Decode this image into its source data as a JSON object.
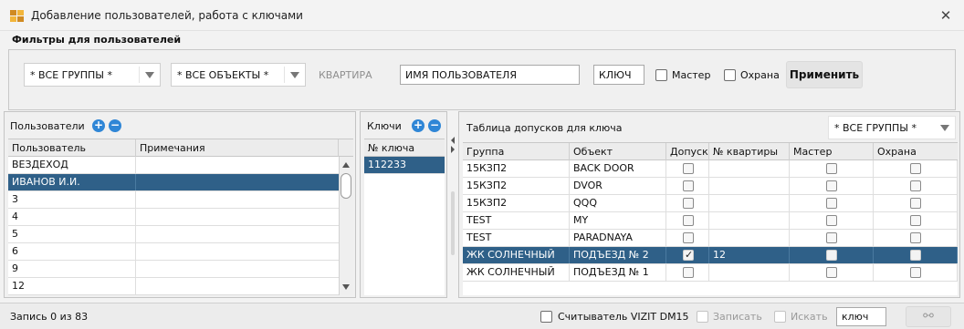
{
  "window": {
    "title": "Добавление пользователей, работа с ключами",
    "close_glyph": "✕"
  },
  "filters": {
    "title": "Фильтры для пользователей",
    "groups_value": "* ВСЕ ГРУППЫ *",
    "objects_value": "* ВСЕ ОБЪЕКТЫ *",
    "apartment_label": "КВАРТИРА",
    "username_value": "ИМЯ ПОЛЬЗОВАТЕЛЯ",
    "key_value": "КЛЮЧ",
    "master_label": "Мастер",
    "guard_label": "Охрана",
    "master_checked": false,
    "guard_checked": false,
    "apply_label": "Применить"
  },
  "users_panel": {
    "title": "Пользователи",
    "add_glyph": "+",
    "remove_glyph": "−",
    "columns": [
      "Пользователь",
      "Примечания"
    ],
    "rows": [
      {
        "user": "ВЕЗДЕХОД",
        "note": "",
        "selected": false
      },
      {
        "user": "ИВАНОВ И.И.",
        "note": "",
        "selected": true
      },
      {
        "user": "3",
        "note": "",
        "selected": false
      },
      {
        "user": "4",
        "note": "",
        "selected": false
      },
      {
        "user": "5",
        "note": "",
        "selected": false
      },
      {
        "user": "6",
        "note": "",
        "selected": false
      },
      {
        "user": "9",
        "note": "",
        "selected": false
      },
      {
        "user": "12",
        "note": "",
        "selected": false
      }
    ]
  },
  "keys_panel": {
    "title": "Ключи",
    "add_glyph": "+",
    "remove_glyph": "−",
    "column": "№ ключа",
    "rows": [
      {
        "key": "112233",
        "selected": true
      }
    ]
  },
  "access_panel": {
    "title": "Таблица допусков для ключа",
    "groups_value": "* ВСЕ ГРУППЫ *",
    "columns": [
      "Группа",
      "Объект",
      "Допуск",
      "№ квартиры",
      "Мастер",
      "Охрана"
    ],
    "rows": [
      {
        "group": "15КЗП2",
        "object": "BACK DOOR",
        "access": false,
        "apartment": "",
        "master": false,
        "guard": false,
        "selected": false
      },
      {
        "group": "15КЗП2",
        "object": "DVOR",
        "access": false,
        "apartment": "",
        "master": false,
        "guard": false,
        "selected": false
      },
      {
        "group": "15КЗП2",
        "object": "QQQ",
        "access": false,
        "apartment": "",
        "master": false,
        "guard": false,
        "selected": false
      },
      {
        "group": "TEST",
        "object": "MY",
        "access": false,
        "apartment": "",
        "master": false,
        "guard": false,
        "selected": false
      },
      {
        "group": "TEST",
        "object": "PARADNAYA",
        "access": false,
        "apartment": "",
        "master": false,
        "guard": false,
        "selected": false
      },
      {
        "group": "ЖК СОЛНЕЧНЫЙ",
        "object": "ПОДЪЕЗД № 2",
        "access": true,
        "apartment": "12",
        "master": false,
        "guard": false,
        "selected": true
      },
      {
        "group": "ЖК СОЛНЕЧНЫЙ",
        "object": "ПОДЪЕЗД № 1",
        "access": false,
        "apartment": "",
        "master": false,
        "guard": false,
        "selected": false
      }
    ]
  },
  "statusbar": {
    "record_text": "Запись 0  из 83",
    "reader_label": "Считыватель  VIZIT DM15",
    "write_label": "Записать",
    "search_label": "Искать",
    "key_field_value": "ключ",
    "link_glyph": "⚯"
  },
  "colors": {
    "selection": "#2f6088",
    "accent_blue": "#2f86d6"
  }
}
